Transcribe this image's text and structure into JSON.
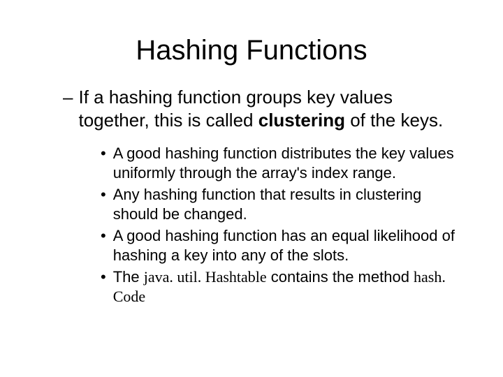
{
  "title": "Hashing Functions",
  "level1": {
    "dash": "–",
    "text_a": "If a hashing function groups key values together, this is called ",
    "text_bold": "clustering",
    "text_b": " of the keys."
  },
  "bullets": [
    {
      "dot": "•",
      "text": "A good hashing function distributes the key values uniformly through the array's index range."
    },
    {
      "dot": "•",
      "text": "Any hashing function that results in clustering should be changed."
    },
    {
      "dot": "•",
      "text": "A good hashing function has an equal likelihood of hashing a key into any of the slots."
    }
  ],
  "bullet_last": {
    "dot": "•",
    "a": "The ",
    "code1": "java. util. Hashtable",
    "b": " contains the method ",
    "code2": "hash. Code"
  }
}
